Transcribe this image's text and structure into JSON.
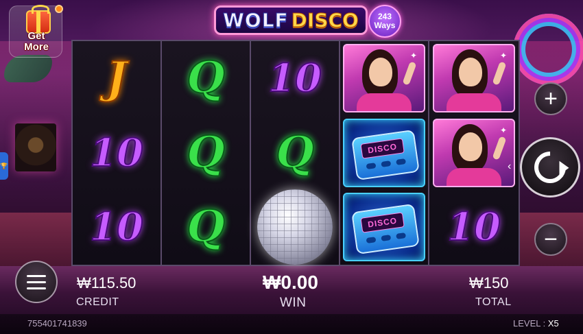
{
  "game": {
    "title_part1": "WOLF",
    "title_part2": "DISCO",
    "ways_number": "243",
    "ways_label": "Ways"
  },
  "promo": {
    "get_more_line1": "Get",
    "get_more_line2": "More"
  },
  "reels": [
    [
      {
        "symbol": "J",
        "type": "letter"
      },
      {
        "symbol": "10",
        "type": "number"
      },
      {
        "symbol": "10",
        "type": "number"
      }
    ],
    [
      {
        "symbol": "Q",
        "type": "letter"
      },
      {
        "symbol": "Q",
        "type": "letter"
      },
      {
        "symbol": "Q",
        "type": "letter"
      }
    ],
    [
      {
        "symbol": "10",
        "type": "number"
      },
      {
        "symbol": "Q",
        "type": "letter"
      },
      {
        "symbol": "disco-ball",
        "type": "image"
      }
    ],
    [
      {
        "symbol": "disco-lady",
        "type": "image"
      },
      {
        "symbol": "pager",
        "type": "image",
        "text": "DISCO"
      },
      {
        "symbol": "pager",
        "type": "image",
        "text": "DISCO"
      }
    ],
    [
      {
        "symbol": "disco-lady",
        "type": "image"
      },
      {
        "symbol": "disco-lady",
        "type": "image"
      },
      {
        "symbol": "10",
        "type": "number"
      }
    ]
  ],
  "controls": {
    "plus_icon": "plus-icon",
    "minus_icon": "minus-icon",
    "spin_icon": "spin-icon",
    "menu_icon": "menu-icon"
  },
  "stats": {
    "credit_value": "₩115.50",
    "credit_label": "CREDIT",
    "win_value": "₩0.00",
    "win_label": "WIN",
    "total_value": "₩150",
    "total_label": "TOTAL"
  },
  "footer": {
    "session_id": "755401741839",
    "level_label": "LEVEL :",
    "level_value": "X5"
  },
  "colors": {
    "accent_pink": "#ff5fc0",
    "letter_J": "#ffb01a",
    "letter_Q": "#3ae04a",
    "number_10": "#c65cff"
  }
}
